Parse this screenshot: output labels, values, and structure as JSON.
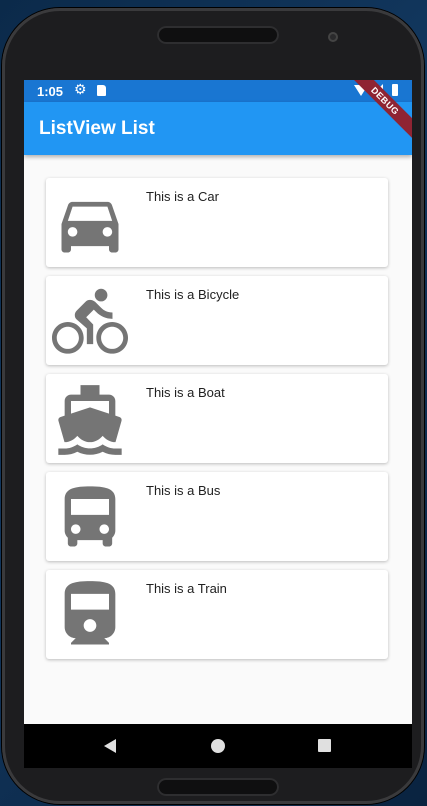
{
  "status_bar": {
    "time": "1:05"
  },
  "app_bar": {
    "title": "ListView List"
  },
  "debug_banner": "DEBUG",
  "colors": {
    "primary": "#2196F3",
    "status": "#1976D2",
    "icon": "#757575"
  },
  "items": [
    {
      "icon": "car-icon",
      "label": "This is a Car"
    },
    {
      "icon": "bicycle-icon",
      "label": "This is a Bicycle"
    },
    {
      "icon": "boat-icon",
      "label": "This is a Boat"
    },
    {
      "icon": "bus-icon",
      "label": "This is a Bus"
    },
    {
      "icon": "train-icon",
      "label": "This is a Train"
    }
  ]
}
